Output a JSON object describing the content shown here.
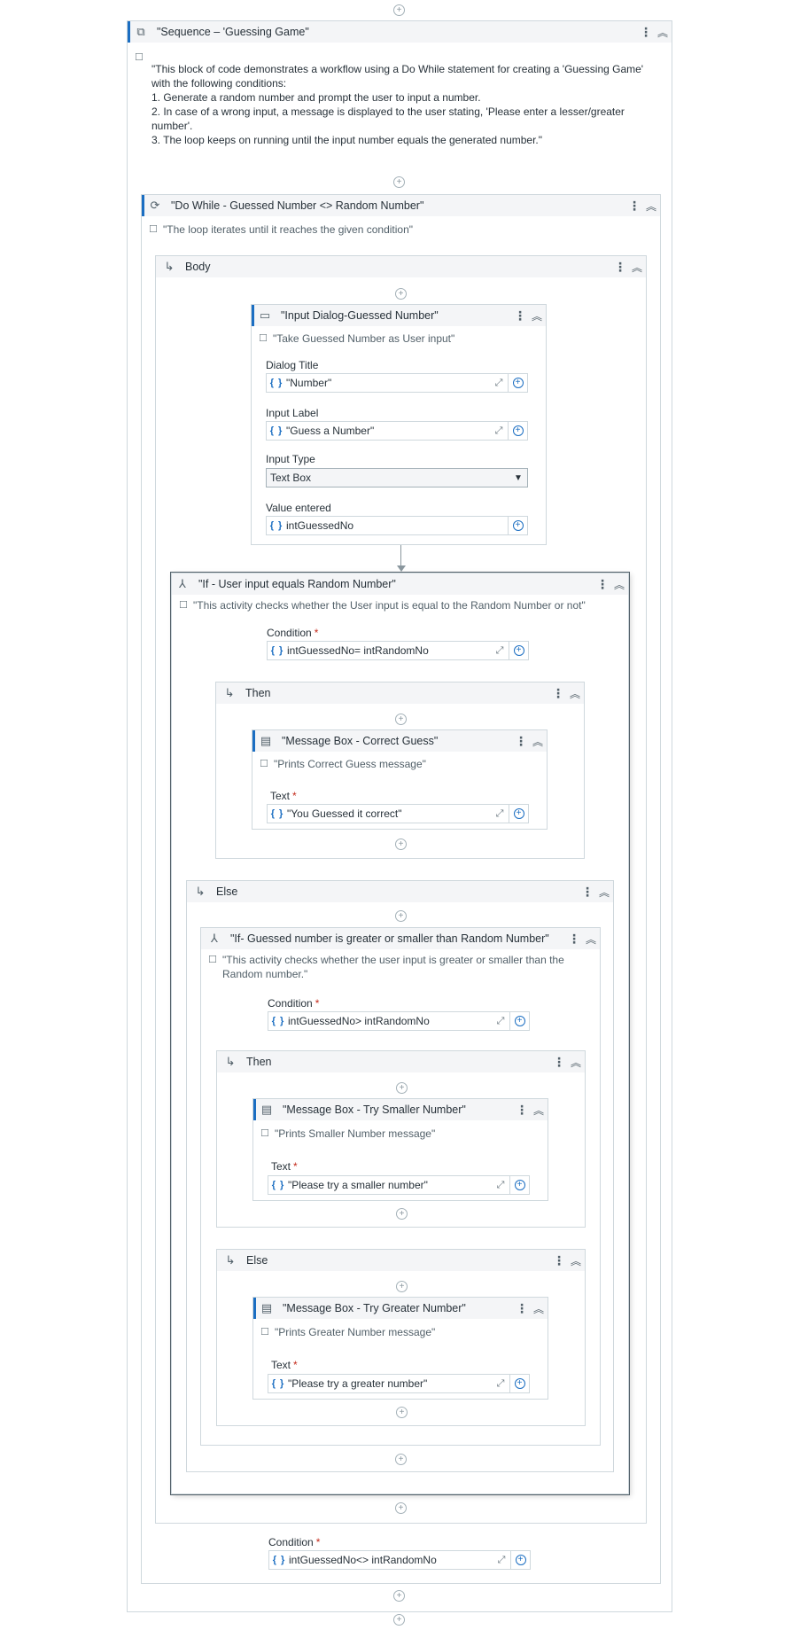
{
  "sequence": {
    "title": "\"Sequence – 'Guessing Game\"",
    "description_lines": [
      "\"This block of code demonstrates a workflow using a Do While statement for creating a 'Guessing Game'",
      "with the following conditions:",
      "1. Generate a random number and prompt the user to input a number.",
      "2. In case of a wrong input, a message is displayed to the user stating, 'Please enter a lesser/greater",
      "number'.",
      "3. The loop keeps on running until the input number equals the generated number.\""
    ]
  },
  "do_while": {
    "title": "\"Do While - Guessed Number <> Random Number\"",
    "annotation": "\"The loop iterates until it reaches the given condition\"",
    "body_label": "Body",
    "condition_label": "Condition",
    "condition_value": "intGuessedNo<> intRandomNo"
  },
  "input_dialog": {
    "title": "\"Input Dialog-Guessed Number\"",
    "annotation": "\"Take Guessed Number as User input\"",
    "dialog_title_label": "Dialog Title",
    "dialog_title_value": "\"Number\"",
    "input_label_label": "Input Label",
    "input_label_value": "\"Guess a Number\"",
    "input_type_label": "Input Type",
    "input_type_value": "Text Box",
    "value_entered_label": "Value entered",
    "value_entered_value": "intGuessedNo"
  },
  "if_outer": {
    "title": "\"If - User input equals Random Number\"",
    "annotation": "\"This activity checks whether the User input is equal to the Random Number or not\"",
    "condition_label": "Condition",
    "condition_value": "intGuessedNo= intRandomNo",
    "then_label": "Then",
    "else_label": "Else"
  },
  "msg_correct": {
    "title": "\"Message Box - Correct Guess\"",
    "annotation": "\"Prints Correct Guess message\"",
    "text_label": "Text",
    "text_value": "\"You Guessed it correct\""
  },
  "if_inner": {
    "title": "\"If- Guessed number is greater or smaller than Random Number\"",
    "annotation_line1": "\"This activity checks whether the user input is greater or smaller than the",
    "annotation_line2": "Random number.\"",
    "condition_label": "Condition",
    "condition_value": "intGuessedNo> intRandomNo",
    "then_label": "Then",
    "else_label": "Else"
  },
  "msg_smaller": {
    "title": "\"Message Box - Try Smaller Number\"",
    "annotation": "\"Prints Smaller Number message\"",
    "text_label": "Text",
    "text_value": "\"Please try a smaller number\""
  },
  "msg_greater": {
    "title": "\"Message Box - Try Greater Number\"",
    "annotation": "\"Prints Greater Number message\"",
    "text_label": "Text",
    "text_value": "\"Please try a greater number\""
  },
  "icons": {
    "plus": "⊕",
    "kebab": "⋮",
    "collapse": "︽",
    "branch": "↳",
    "annotation": "☐",
    "expand": "⤢",
    "braces": "{ }",
    "chevron": "⌄",
    "add": "+"
  },
  "colors": {
    "accent": "#1b6ec2",
    "header_bg": "#f4f5f7",
    "border": "#cfd8dd",
    "required": "#c42b1c"
  }
}
